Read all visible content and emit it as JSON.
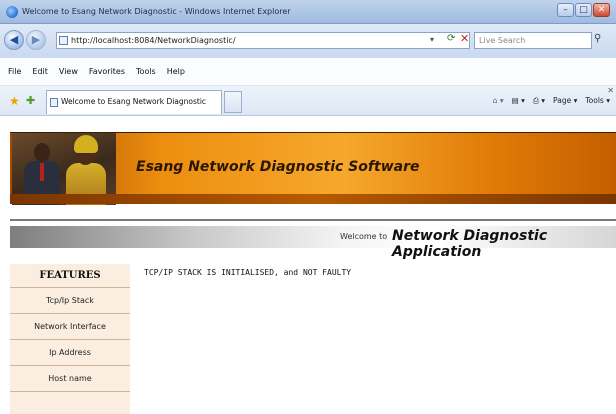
{
  "window": {
    "title": "Welcome to Esang Network Diagnostic - Windows Internet Explorer",
    "minimize_icon": "minimize-icon",
    "maximize_icon": "maximize-icon",
    "close_icon": "close-icon"
  },
  "address_bar": {
    "url": "http://localhost:8084/NetworkDiagnostic/",
    "search_placeholder": "Live Search"
  },
  "menu": [
    "File",
    "Edit",
    "View",
    "Favorites",
    "Tools",
    "Help"
  ],
  "favorites_bar": {
    "tab_title": "Welcome to Esang Network Diagnostic",
    "commands": [
      "Page",
      "Tools"
    ]
  },
  "banner": {
    "title": "Esang Network Diagnostic Software"
  },
  "welcome": {
    "lead": "Welcome to",
    "app_name": "Network Diagnostic Application"
  },
  "sidebar": {
    "heading": "FEATURES",
    "items": [
      {
        "label": "Tcp/Ip Stack"
      },
      {
        "label": "Network Interface"
      },
      {
        "label": "Ip Address"
      },
      {
        "label": "Host name"
      }
    ]
  },
  "status_message": "TCP/IP STACK IS INITIALISED, and NOT FAULTY",
  "colors": {
    "banner_orange": "#ec8e0f",
    "sidebar_bg": "#fbeee0",
    "ie_chrome": "#c9d9ef"
  }
}
